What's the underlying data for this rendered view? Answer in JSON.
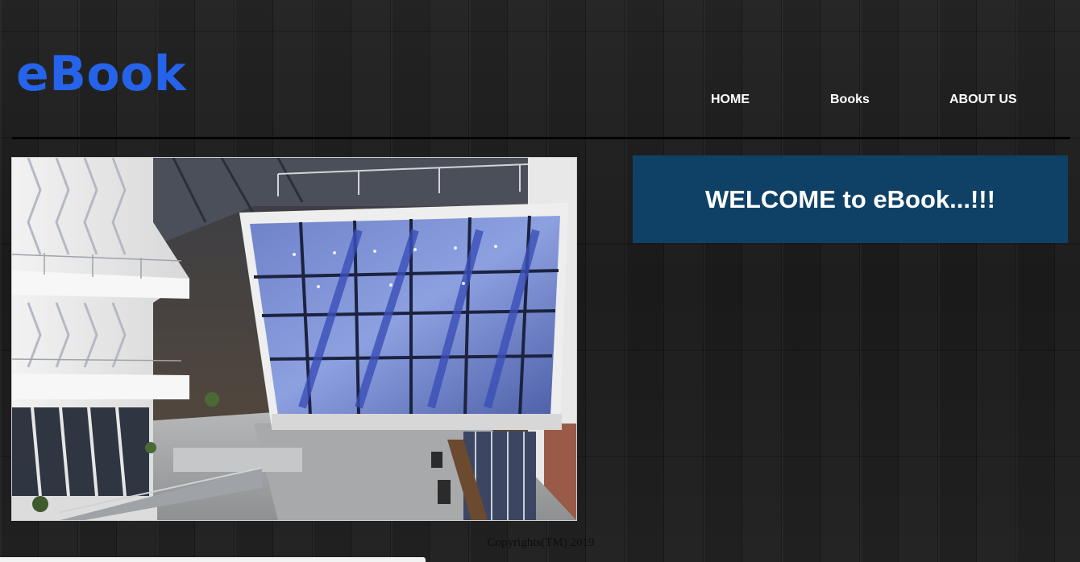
{
  "header": {
    "logo_text": "eBook"
  },
  "nav": {
    "items": [
      {
        "label": "HOME"
      },
      {
        "label": "Books"
      },
      {
        "label": "ABOUT US"
      }
    ]
  },
  "welcome": {
    "title": "WELCOME to eBook...!!!"
  },
  "footer": {
    "text": "Copyrights(TM) 2019"
  },
  "colors": {
    "logo": "#2563eb",
    "welcome_bg": "#0f4166",
    "nav_text": "#ffffff"
  }
}
